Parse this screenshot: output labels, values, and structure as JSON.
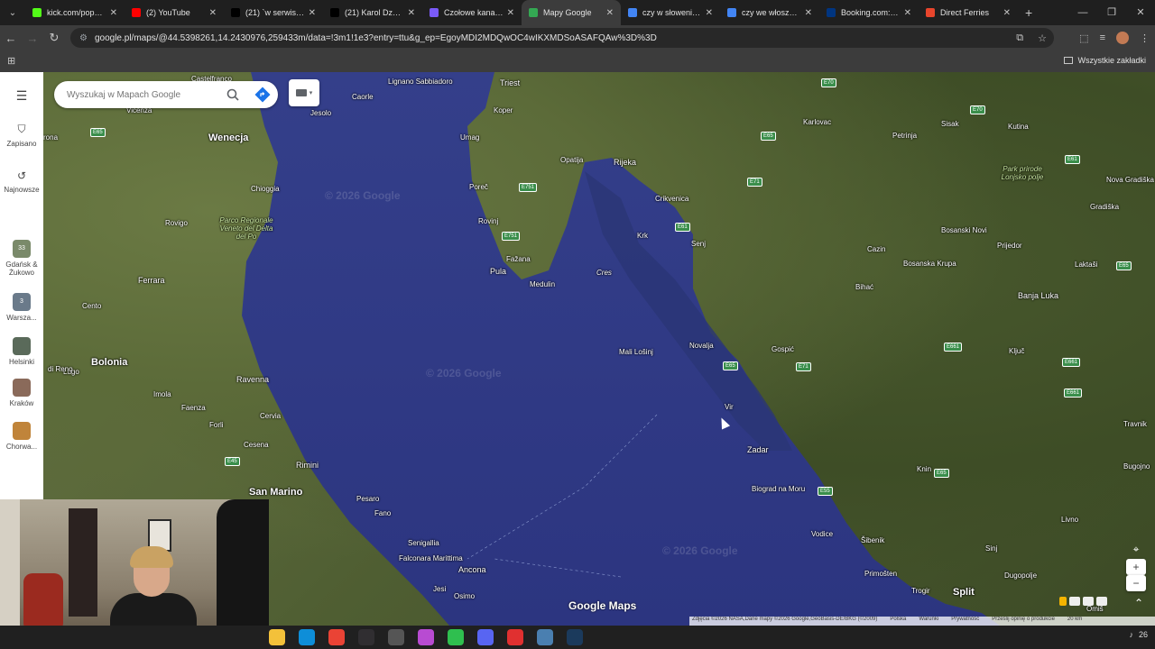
{
  "tabs": [
    {
      "label": "kick.com/popout/",
      "favicon_color": "#53fc18",
      "active": false
    },
    {
      "label": "(2) YouTube",
      "favicon_color": "#ff0000",
      "active": false
    },
    {
      "label": "(21) `w serwisie X",
      "favicon_color": "#000000",
      "active": false
    },
    {
      "label": "(21) Karol Dzonso",
      "favicon_color": "#000000",
      "active": false
    },
    {
      "label": "Czołowe kanały -",
      "favicon_color": "#7a5af8",
      "active": false
    },
    {
      "label": "Mapy Google",
      "favicon_color": "#34a853",
      "active": true
    },
    {
      "label": "czy w słoweni mo",
      "favicon_color": "#4285f4",
      "active": false
    },
    {
      "label": "czy we włoszech",
      "favicon_color": "#4285f4",
      "active": false
    },
    {
      "label": "Booking.com: Ho",
      "favicon_color": "#003580",
      "active": false
    },
    {
      "label": "Direct Ferries",
      "favicon_color": "#e8452c",
      "active": false
    }
  ],
  "address": {
    "url": "google.pl/maps/@44.5398261,14.2430976,259433m/data=!3m1!1e3?entry=ttu&g_ep=EgoyMDI2MDQwOC4wIKXMDSoASAFQAw%3D%3D"
  },
  "bookmarks": {
    "all_label": "Wszystkie zakładki"
  },
  "search": {
    "placeholder": "Wyszukaj w Mapach Google"
  },
  "sidebar": {
    "saved_label": "Zapisano",
    "recent_label": "Najnowsze",
    "recent_items": [
      {
        "label": "Gdańsk & Żukowo",
        "badge": "33",
        "color": "#7a8a6a"
      },
      {
        "label": "Warsza...",
        "badge": "3",
        "color": "#6a7a8a"
      },
      {
        "label": "Helsinki",
        "badge": "",
        "color": "#5a6a5a"
      },
      {
        "label": "Kraków",
        "badge": "",
        "color": "#8a6a5a"
      },
      {
        "label": "Chorwa...",
        "badge": "",
        "color": "#c0843a"
      }
    ]
  },
  "map_labels": [
    {
      "text": "Wenecja",
      "cls": "big"
    },
    {
      "text": "Bolonia",
      "cls": "big"
    },
    {
      "text": "San Marino",
      "cls": "big"
    },
    {
      "text": "Triest",
      "cls": "city"
    },
    {
      "text": "Rijeka",
      "cls": "city"
    },
    {
      "text": "Zadar",
      "cls": "city"
    },
    {
      "text": "Split",
      "cls": "big"
    },
    {
      "text": "Ancona",
      "cls": "city"
    },
    {
      "text": "Chioggia",
      "cls": ""
    },
    {
      "text": "Rovigo",
      "cls": ""
    },
    {
      "text": "Ferrara",
      "cls": "city"
    },
    {
      "text": "Cento",
      "cls": ""
    },
    {
      "text": "Ravenna",
      "cls": "city"
    },
    {
      "text": "Imola",
      "cls": ""
    },
    {
      "text": "Faenza",
      "cls": ""
    },
    {
      "text": "Forli",
      "cls": ""
    },
    {
      "text": "Cervia",
      "cls": ""
    },
    {
      "text": "Cesena",
      "cls": ""
    },
    {
      "text": "Rimini",
      "cls": "city"
    },
    {
      "text": "Pesaro",
      "cls": ""
    },
    {
      "text": "Fano",
      "cls": ""
    },
    {
      "text": "Senigallia",
      "cls": ""
    },
    {
      "text": "Falconara Marittima",
      "cls": ""
    },
    {
      "text": "Osimo",
      "cls": ""
    },
    {
      "text": "Jesi",
      "cls": ""
    },
    {
      "text": "Jesolo",
      "cls": ""
    },
    {
      "text": "Caorle",
      "cls": ""
    },
    {
      "text": "Lignano Sabbiadoro",
      "cls": ""
    },
    {
      "text": "Koper",
      "cls": ""
    },
    {
      "text": "Umag",
      "cls": ""
    },
    {
      "text": "Poreč",
      "cls": ""
    },
    {
      "text": "Rovinj",
      "cls": ""
    },
    {
      "text": "Pula",
      "cls": "city"
    },
    {
      "text": "Fažana",
      "cls": ""
    },
    {
      "text": "Medulin",
      "cls": ""
    },
    {
      "text": "Opatija",
      "cls": ""
    },
    {
      "text": "Crikvenica",
      "cls": ""
    },
    {
      "text": "Krk",
      "cls": ""
    },
    {
      "text": "Cres",
      "cls": "italic"
    },
    {
      "text": "Senj",
      "cls": ""
    },
    {
      "text": "Mali Lošinj",
      "cls": ""
    },
    {
      "text": "Novalja",
      "cls": ""
    },
    {
      "text": "Vir",
      "cls": ""
    },
    {
      "text": "Biograd na Moru",
      "cls": ""
    },
    {
      "text": "Vodice",
      "cls": ""
    },
    {
      "text": "Šibenik",
      "cls": ""
    },
    {
      "text": "Primošten",
      "cls": ""
    },
    {
      "text": "Trogir",
      "cls": ""
    },
    {
      "text": "Karlovac",
      "cls": ""
    },
    {
      "text": "Petrinja",
      "cls": ""
    },
    {
      "text": "Sisak",
      "cls": ""
    },
    {
      "text": "Kutina",
      "cls": ""
    },
    {
      "text": "Park prirode Lonjsko polje",
      "cls": "green"
    },
    {
      "text": "Nova Gradiška",
      "cls": ""
    },
    {
      "text": "Gradiška",
      "cls": ""
    },
    {
      "text": "Bosanski Novi",
      "cls": ""
    },
    {
      "text": "Prijedor",
      "cls": ""
    },
    {
      "text": "Laktaši",
      "cls": ""
    },
    {
      "text": "Banja Luka",
      "cls": "city"
    },
    {
      "text": "Cazin",
      "cls": ""
    },
    {
      "text": "Bosanska Krupa",
      "cls": ""
    },
    {
      "text": "Bihać",
      "cls": ""
    },
    {
      "text": "Gospić",
      "cls": ""
    },
    {
      "text": "Ključ",
      "cls": ""
    },
    {
      "text": "Travnik",
      "cls": ""
    },
    {
      "text": "Knin",
      "cls": ""
    },
    {
      "text": "Bugojno",
      "cls": ""
    },
    {
      "text": "Livno",
      "cls": ""
    },
    {
      "text": "Sinj",
      "cls": ""
    },
    {
      "text": "Dugopolje",
      "cls": ""
    },
    {
      "text": "Omiš",
      "cls": ""
    },
    {
      "text": "Parco Regionale Veneto del Delta del Po",
      "cls": "green"
    },
    {
      "text": "Lugo",
      "cls": ""
    },
    {
      "text": "Castelfranco",
      "cls": ""
    },
    {
      "text": "Vicenza",
      "cls": ""
    },
    {
      "text": "rona",
      "cls": ""
    },
    {
      "text": "di Reno",
      "cls": ""
    }
  ],
  "road_shields": [
    "E70",
    "E65",
    "E751",
    "E751",
    "E61",
    "E71",
    "E65",
    "E61",
    "E71",
    "E65",
    "E55",
    "E45",
    "E661",
    "E661",
    "E661",
    "E70",
    "E65",
    "E65"
  ],
  "map_controls": {
    "zoom_in": "+",
    "zoom_out": "−",
    "expand": "⌃"
  },
  "google_logo": "Google Maps",
  "attribution": {
    "imagery": "Zdjęcia ©2026 NASA,Dane mapy ©2026 Google,GeoBasis-DE/BKG (©2009)",
    "country": "Polska",
    "terms": "Warunki",
    "privacy": "Prywatność",
    "feedback": "Prześlij opinię o produkcie",
    "scale": "20 km"
  },
  "taskbar_apps": [
    {
      "name": "file-explorer",
      "color": "#f3c13a"
    },
    {
      "name": "edge",
      "color": "#0e8ed8"
    },
    {
      "name": "chrome",
      "color": "#ea4335"
    },
    {
      "name": "obs",
      "color": "#302e31"
    },
    {
      "name": "settings",
      "color": "#555555"
    },
    {
      "name": "photos",
      "color": "#b84bd2"
    },
    {
      "name": "player",
      "color": "#2fbf4f"
    },
    {
      "name": "discord",
      "color": "#5865f2"
    },
    {
      "name": "recorder",
      "color": "#e03030"
    },
    {
      "name": "app-blue",
      "color": "#4a7fb0"
    },
    {
      "name": "steam",
      "color": "#1b3a5c"
    }
  ],
  "tray": {
    "text": "26"
  }
}
